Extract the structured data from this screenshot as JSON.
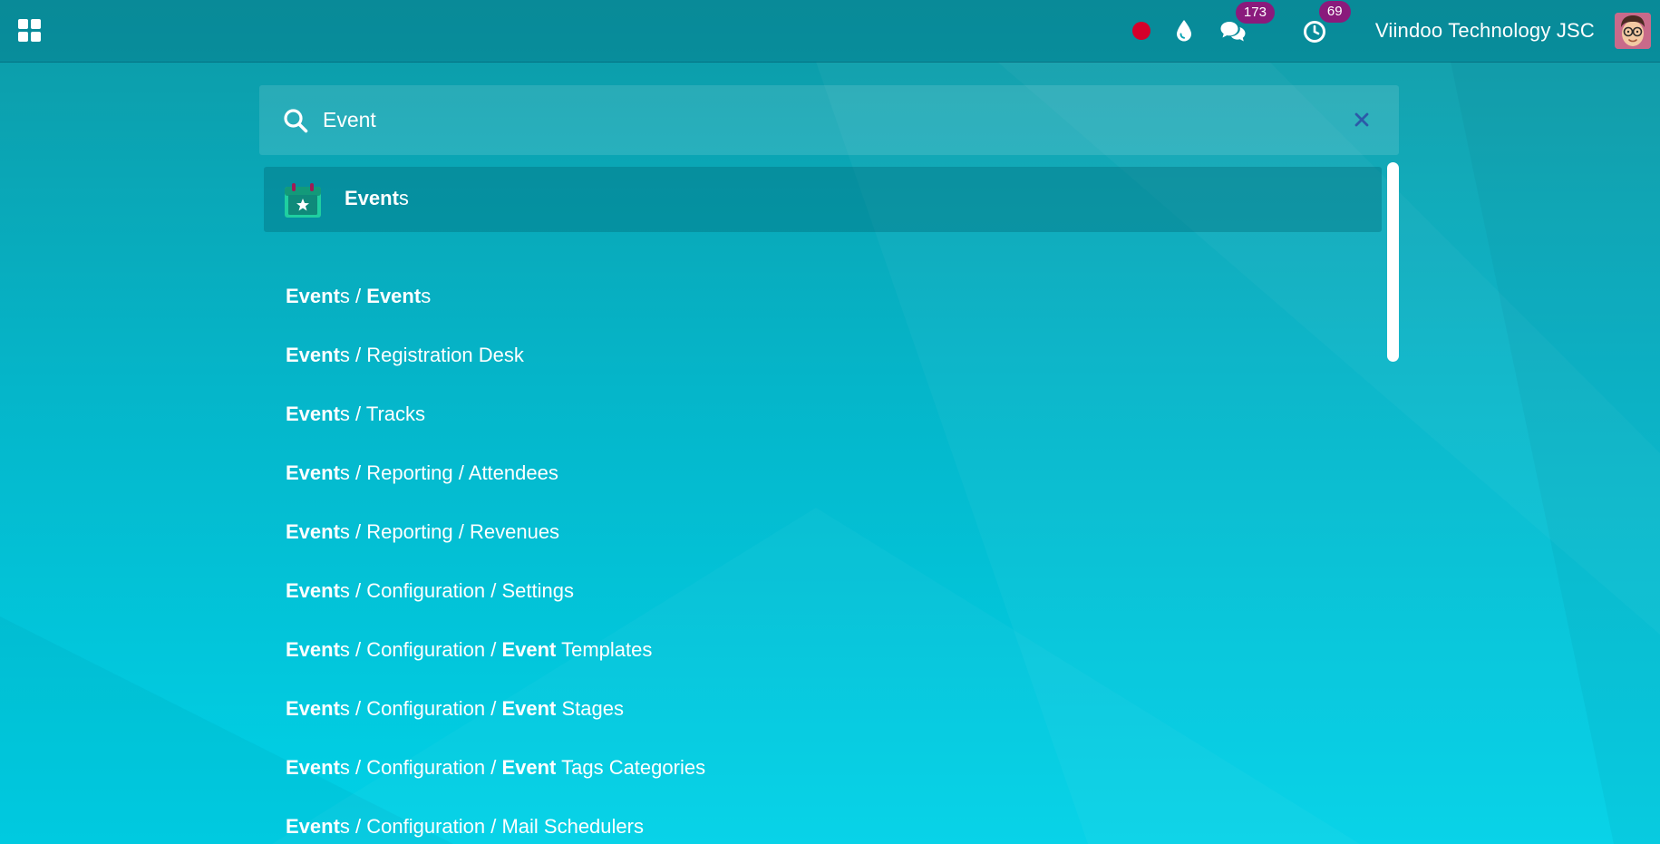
{
  "topbar": {
    "chat_count": "173",
    "activity_count": "69",
    "company": "Viindoo Technology JSC"
  },
  "search": {
    "value": "Event"
  },
  "app_result": {
    "match": "Event",
    "rest": "s"
  },
  "menu_items": [
    {
      "segments": [
        {
          "t": "Event",
          "b": true
        },
        {
          "t": "s / ",
          "b": false
        },
        {
          "t": "Event",
          "b": true
        },
        {
          "t": "s",
          "b": false
        }
      ]
    },
    {
      "segments": [
        {
          "t": "Event",
          "b": true
        },
        {
          "t": "s / Registration Desk",
          "b": false
        }
      ]
    },
    {
      "segments": [
        {
          "t": "Event",
          "b": true
        },
        {
          "t": "s / Tracks",
          "b": false
        }
      ]
    },
    {
      "segments": [
        {
          "t": "Event",
          "b": true
        },
        {
          "t": "s / Reporting / Attendees",
          "b": false
        }
      ]
    },
    {
      "segments": [
        {
          "t": "Event",
          "b": true
        },
        {
          "t": "s / Reporting / Revenues",
          "b": false
        }
      ]
    },
    {
      "segments": [
        {
          "t": "Event",
          "b": true
        },
        {
          "t": "s / Configuration / Settings",
          "b": false
        }
      ]
    },
    {
      "segments": [
        {
          "t": "Event",
          "b": true
        },
        {
          "t": "s / Configuration / ",
          "b": false
        },
        {
          "t": "Event",
          "b": true
        },
        {
          "t": " Templates",
          "b": false
        }
      ]
    },
    {
      "segments": [
        {
          "t": "Event",
          "b": true
        },
        {
          "t": "s / Configuration / ",
          "b": false
        },
        {
          "t": "Event",
          "b": true
        },
        {
          "t": " Stages",
          "b": false
        }
      ]
    },
    {
      "segments": [
        {
          "t": "Event",
          "b": true
        },
        {
          "t": "s / Configuration / ",
          "b": false
        },
        {
          "t": "Event",
          "b": true
        },
        {
          "t": " Tags Categories",
          "b": false
        }
      ]
    },
    {
      "segments": [
        {
          "t": "Event",
          "b": true
        },
        {
          "t": "s / Configuration / Mail Schedulers",
          "b": false
        }
      ]
    }
  ],
  "colors": {
    "record": "#d6002a",
    "badge": "#8a1a7c",
    "app_icon": "#1fcfa0"
  },
  "icons": [
    "apps-grid-icon",
    "record-dot-icon",
    "droplet-icon",
    "chat-icon",
    "clock-icon",
    "search-icon",
    "close-icon",
    "calendar-star-icon"
  ]
}
